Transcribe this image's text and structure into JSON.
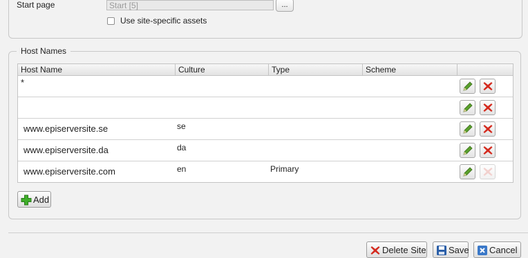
{
  "site_settings": {
    "start_page_label": "Start page",
    "start_page_value": "Start [5]",
    "browse_label": "...",
    "site_assets_label": "Use site-specific assets"
  },
  "host_names": {
    "legend": "Host Names",
    "columns": [
      "Host Name",
      "Culture",
      "Type",
      "Scheme"
    ],
    "rows": [
      {
        "host": "*",
        "culture": "",
        "type": "",
        "scheme": "",
        "delete_enabled": true
      },
      {
        "host": "",
        "culture": "",
        "type": "",
        "scheme": "",
        "delete_enabled": true
      },
      {
        "host": "www.episerversite.se",
        "culture": "se",
        "type": "",
        "scheme": "",
        "delete_enabled": true
      },
      {
        "host": "www.episerversite.da",
        "culture": "da",
        "type": "",
        "scheme": "",
        "delete_enabled": true
      },
      {
        "host": "www.episerversite.com",
        "culture": "en",
        "type": "Primary",
        "scheme": "",
        "delete_enabled": false
      }
    ],
    "add_label": "Add"
  },
  "footer": {
    "delete_site_label": "Delete Site",
    "save_label": "Save",
    "cancel_label": "Cancel"
  },
  "icons": {
    "edit": "pencil-icon",
    "delete": "red-x-icon",
    "add": "green-plus-icon",
    "save": "floppy-disk-icon",
    "cancel": "cancel-icon"
  },
  "colors": {
    "edit_green": "#5aa02c",
    "delete_red": "#d42a1e",
    "add_green": "#3fae2a",
    "save_blue": "#2b5fa8"
  }
}
